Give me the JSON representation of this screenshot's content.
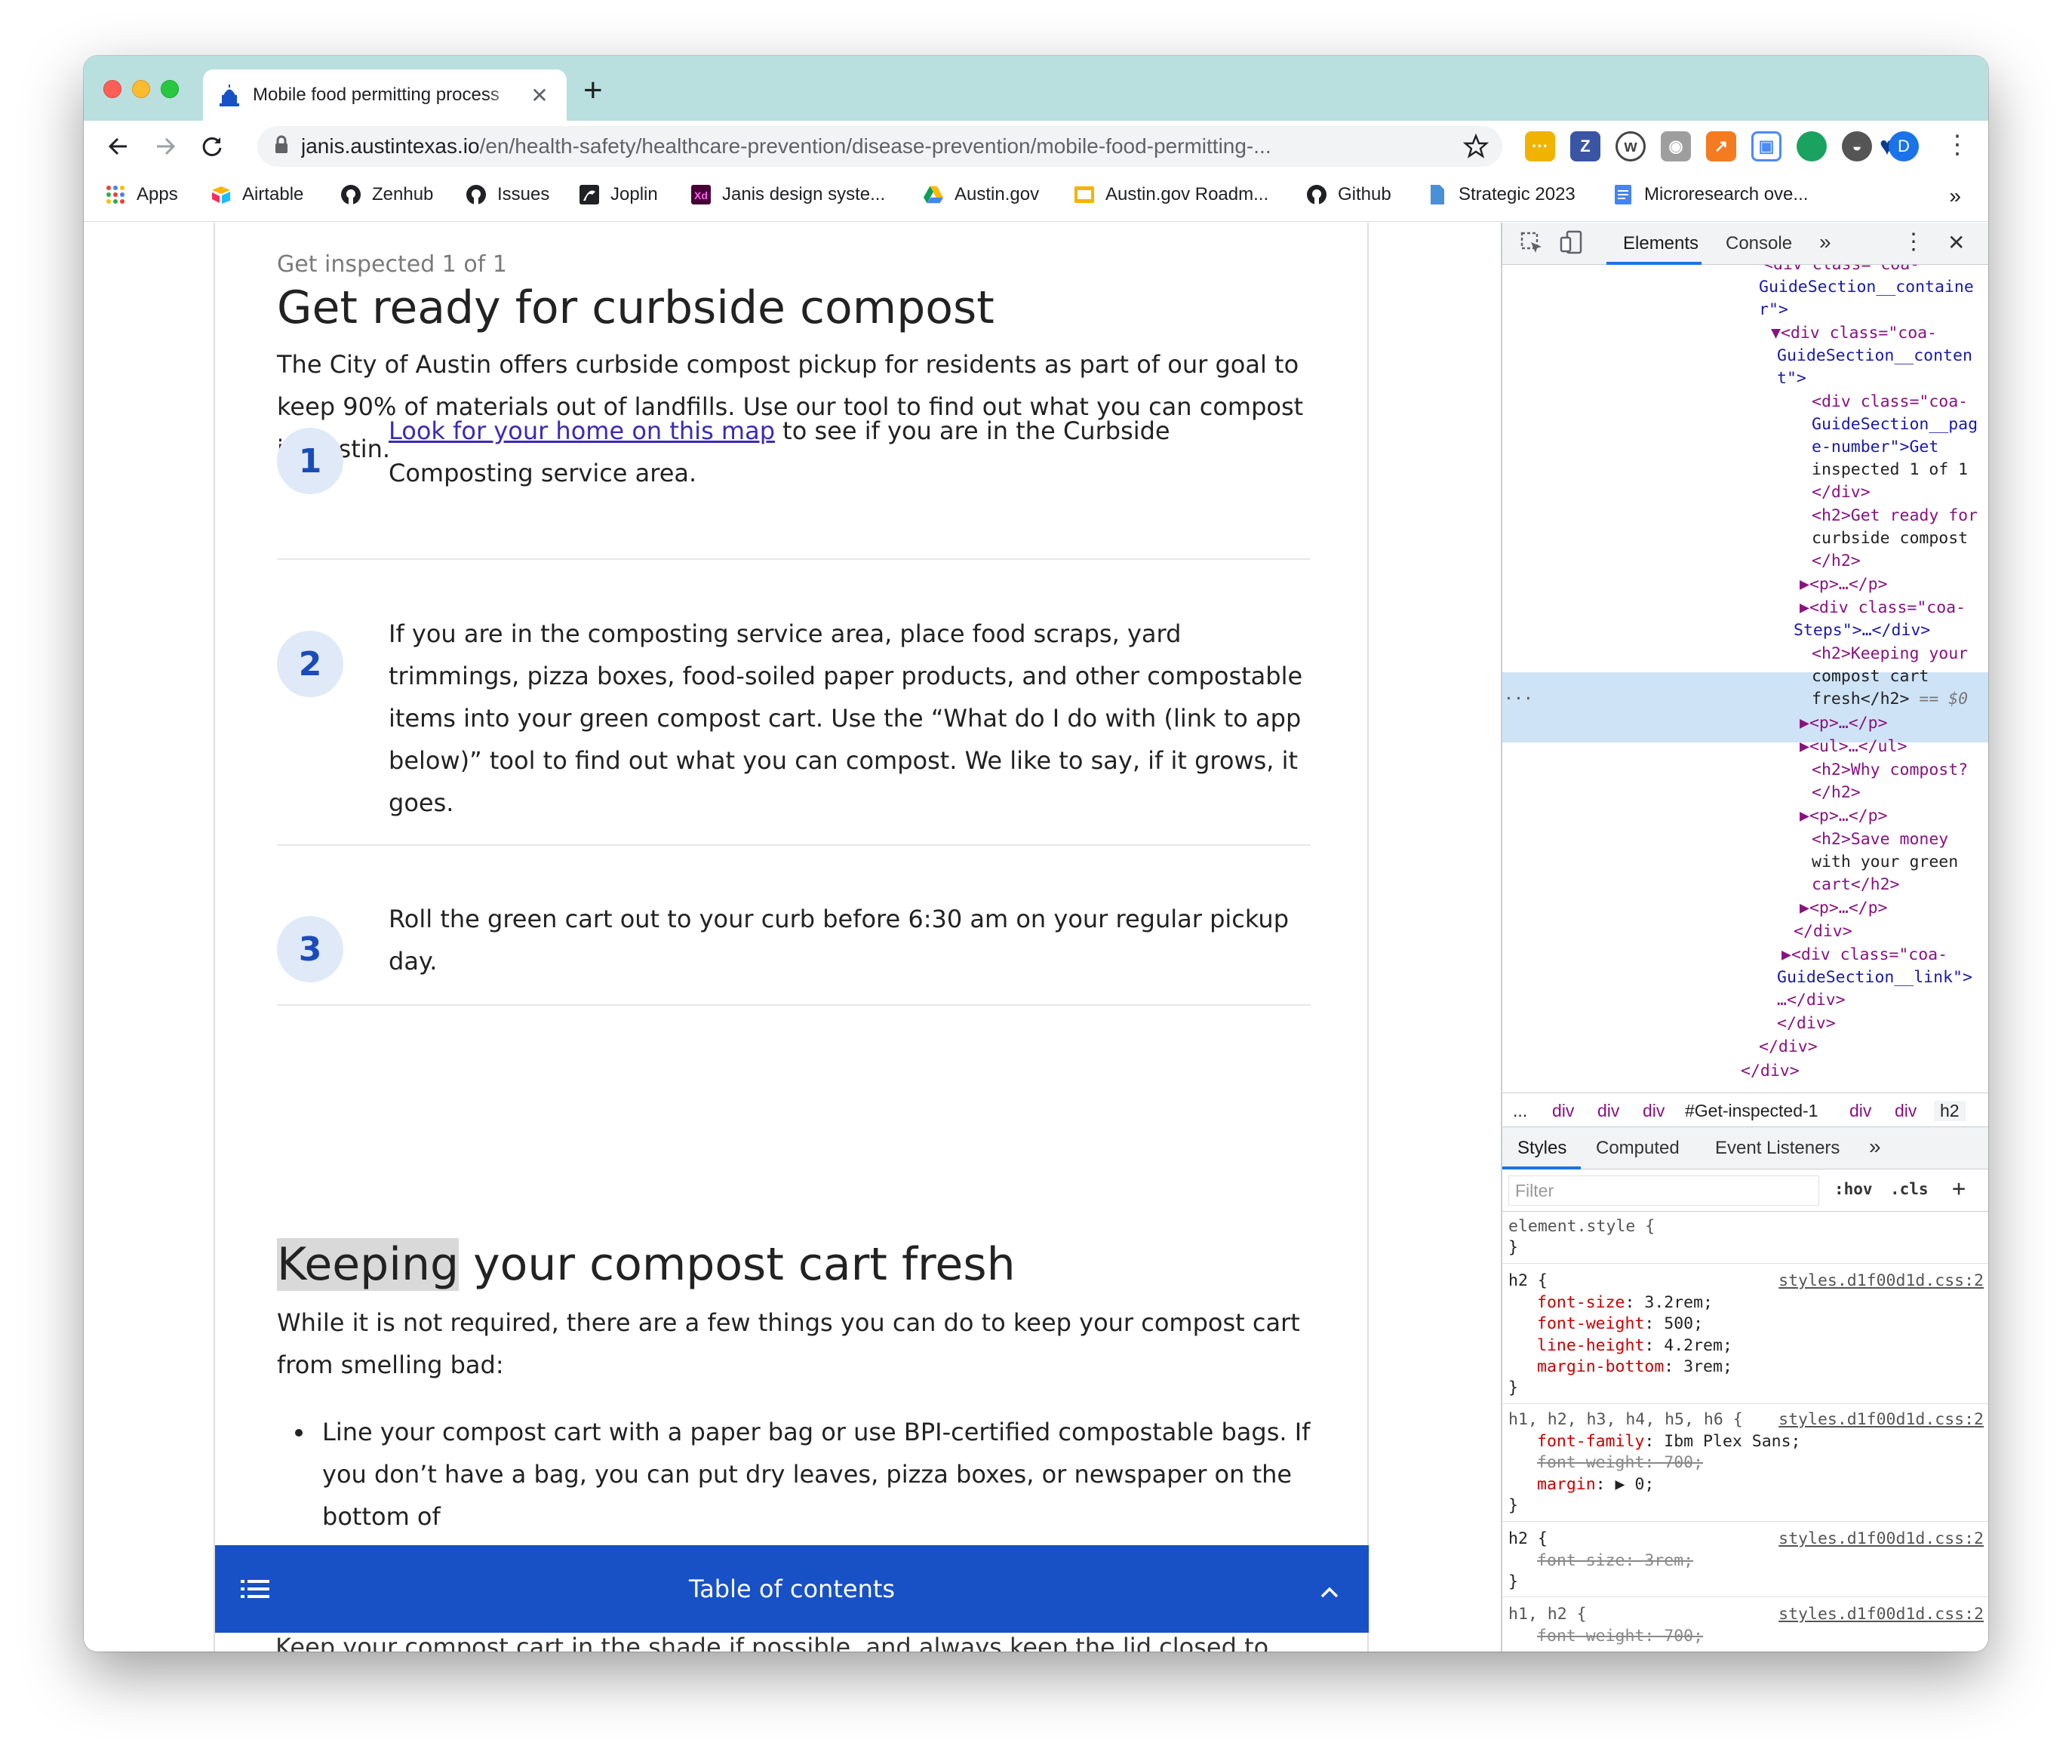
{
  "browser": {
    "tab_title": "Mobile food permitting process",
    "url_host": "janis.austintexas.io",
    "url_path": "/en/health-safety/healthcare-prevention/disease-prevention/mobile-food-permitting-...",
    "profile_initial": "D",
    "bookmarks": [
      "Apps",
      "Airtable",
      "Zenhub",
      "Issues",
      "Joplin",
      "Janis design syste...",
      "Austin.gov",
      "Austin.gov Roadm...",
      "Github",
      "Strategic 2023",
      "Microresearch ove..."
    ],
    "extension_z": "Z"
  },
  "page": {
    "page_number": "Get inspected 1 of 1",
    "title": "Get ready for curbside compost",
    "intro": "The City of Austin offers curbside compost pickup for residents as part of our goal to keep 90% of materials out of landfills. Use our tool to find out what you can compost in Austin.",
    "steps": [
      {
        "num": "1",
        "link": "Look for your home on this map",
        "text": " to see if you are in the Curbside Composting service area."
      },
      {
        "num": "2",
        "link": "",
        "text": "If you are in the composting service area, place food scraps, yard trimmings, pizza boxes, food-soiled paper products, and other compostable items into your green compost cart. Use the “What do I do with (link to app below)” tool to find out what you can compost. We like to say, if it grows, it goes."
      },
      {
        "num": "3",
        "link": "",
        "text": "Roll the green cart out to your curb before 6:30 am on your regular pickup day."
      }
    ],
    "section2_title_highlight": "Keeping",
    "section2_title_rest": " your compost cart fresh",
    "section2_intro": "While it is not required, there are a few things you can do to keep your compost cart from smelling bad:",
    "bullet1": "Line your compost cart with a paper bag or use BPI-certified compostable bags. If you don’t have a bag, you can put dry leaves, pizza boxes, or newspaper on the bottom of",
    "below_toc": "Keep your compost cart in the shade if possible, and always keep the lid closed to",
    "toc_label": "Table of contents"
  },
  "devtools": {
    "tabs": [
      "Elements",
      "Console"
    ],
    "breadcrumbs": [
      "...",
      "div",
      "div",
      "div",
      "#Get-inspected-1",
      "div",
      "div",
      "h2"
    ],
    "style_tabs": [
      "Styles",
      "Computed",
      "Event Listeners"
    ],
    "filter_placeholder": "Filter",
    "hov": ":hov",
    "cls": ".cls",
    "selected_marker": "...",
    "dom": {
      "l0": "<div class=\"coa-",
      "l1": "GuideSection__containe",
      "l2": "r\">",
      "l3": "▼<div class=\"coa-",
      "l4": "GuideSection__conten",
      "l5": "t\">",
      "l6": "<div class=\"coa-",
      "l7": "GuideSection__pag",
      "l8": "e-number\">Get",
      "l9": "inspected 1 of 1",
      "l10": "</div>",
      "l11": "<h2>Get ready for",
      "l12": "curbside compost",
      "l13": "</h2>",
      "l14": "▶<p>…</p>",
      "l15": "▶<div class=\"coa-",
      "l16": "Steps\">…</div>",
      "l17": "<h2>Keeping your",
      "l18": "compost cart",
      "l19": "fresh</h2>",
      "l19b": " == $0",
      "l20": "▶<p>…</p>",
      "l21": "▶<ul>…</ul>",
      "l22": "<h2>Why compost?",
      "l23": "</h2>",
      "l24": "▶<p>…</p>",
      "l25": "<h2>Save money",
      "l26": "with your green",
      "l27": "cart</h2>",
      "l28": "▶<p>…</p>",
      "l29": "</div>",
      "l30": "▶<div class=\"coa-",
      "l31": "GuideSection__link\">",
      "l32": "…</div>",
      "l33": "</div>",
      "l34": "</div>",
      "l35": "</div>"
    },
    "rules": {
      "element_style": "element.style {",
      "close": "}",
      "r1_sel": "h2 {",
      "r1_src": "styles.d1f00d1d.css:2",
      "r1_p1": "font-size",
      "r1_v1": ": 3.2rem;",
      "r1_p2": "font-weight",
      "r1_v2": ": 500;",
      "r1_p3": "line-height",
      "r1_v3": ": 4.2rem;",
      "r1_p4": "margin-bottom",
      "r1_v4": ": 3rem;",
      "r2_sel": "h1, h2, h3, h4, h5, h6 {",
      "r2_src": "styles.d1f00d1d.css:2",
      "r2_p1": "font-family",
      "r2_v1": ": Ibm Plex Sans;",
      "r2_p2": "font-weight: 700;",
      "r2_p3": "margin",
      "r2_v3": ": ▶ 0;",
      "r3_sel": "h2 {",
      "r3_src": "styles.d1f00d1d.css:2",
      "r3_p1": "font-size: 3rem;",
      "r4_sel": "h1, h2 {",
      "r4_src": "styles.d1f00d1d.css:2",
      "r4_p1": "font-weight: 700;"
    }
  },
  "colors": {
    "tabstrip": "#b9dfdf",
    "accent_blue": "#1751c5",
    "step_circle": "#dfe9f7",
    "devtools_selection": "#cfe3f7"
  }
}
